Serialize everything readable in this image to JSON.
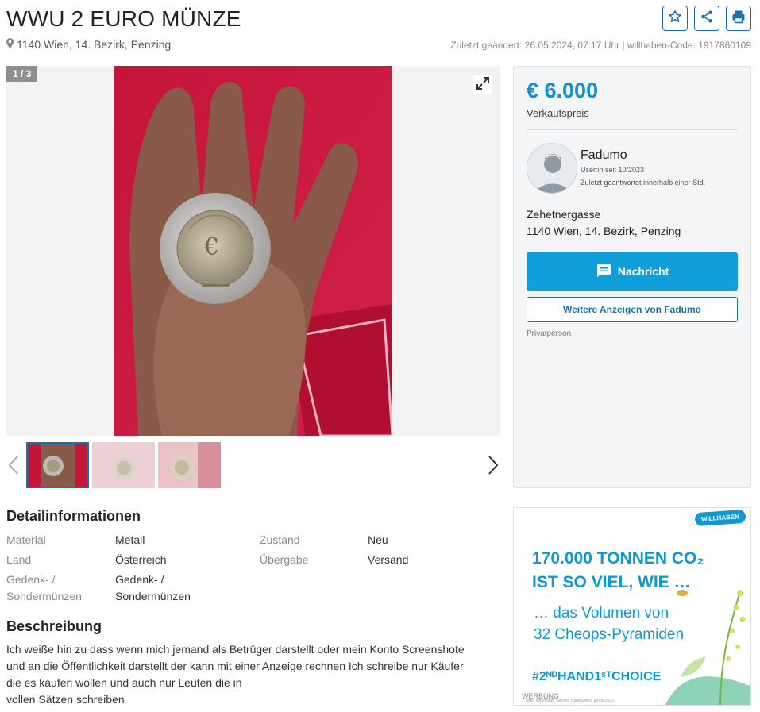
{
  "header": {
    "title": "WWU 2 EURO MÜNZE",
    "location": "1140 Wien, 14. Bezirk, Penzing",
    "meta": "Zuletzt geändert: 26.05.2024, 07:17 Uhr | willhaben-Code: 1917860109",
    "actions": [
      "star-icon",
      "share-icon",
      "print-icon"
    ]
  },
  "gallery": {
    "counter": "1 / 3",
    "expand_icon": "expand-icon"
  },
  "sidebar": {
    "price": "€ 6.000",
    "price_label": "Verkaufspreis",
    "seller_name": "Fadumo",
    "seller_since": "User:in seit 10/2023",
    "seller_response": "Zuletzt geantwortet innerhalb einer Std.",
    "address_street": "Zehetnergasse",
    "address_city": "1140 Wien, 14. Bezirk, Penzing",
    "message_button": "Nachricht",
    "more_button": "Weitere Anzeigen von Fadumo",
    "seller_type": "Privatperson"
  },
  "details": {
    "heading": "Detailinformationen",
    "left": [
      {
        "key": "Material",
        "value": "Metall"
      },
      {
        "key": "Land",
        "value": "Österreich"
      },
      {
        "key": "Gedenk- / Sondermünzen",
        "value": "Gedenk- / Sondermünzen"
      }
    ],
    "right": [
      {
        "key": "Zustand",
        "value": "Neu"
      },
      {
        "key": "Übergabe",
        "value": "Versand"
      }
    ]
  },
  "description": {
    "heading": "Beschreibung",
    "line1": "Ich weiße hin zu dass wenn mich jemand als Betrüger darstellt oder mein Konto Screenshote",
    "line2": "und an die Öffentlichkeit darstellt der kann mit einer Anzeige rechnen Ich schreibe nur Käufer",
    "line3": "die es kaufen wollen und auch nur Leuten die in",
    "line4": "vollen Sätzen schreiben"
  },
  "ad": {
    "logo": "WILLHABEN",
    "line1": "170.000 TONNEN CO₂",
    "line2": "IST SO VIEL, WIE …",
    "line3": "… das Volumen von",
    "line4": "32 Cheops-Pyramiden",
    "tagline": "#2ᴺᴰHAND1ˢᵀCHOICE",
    "werbung": "WERBUNG",
    "small": "…ante, Marktplatz, Second Hand Effect, Ethos 2023"
  },
  "colors": {
    "accent": "#0f9ed8",
    "link": "#1a70ad",
    "price": "#1290d6"
  }
}
